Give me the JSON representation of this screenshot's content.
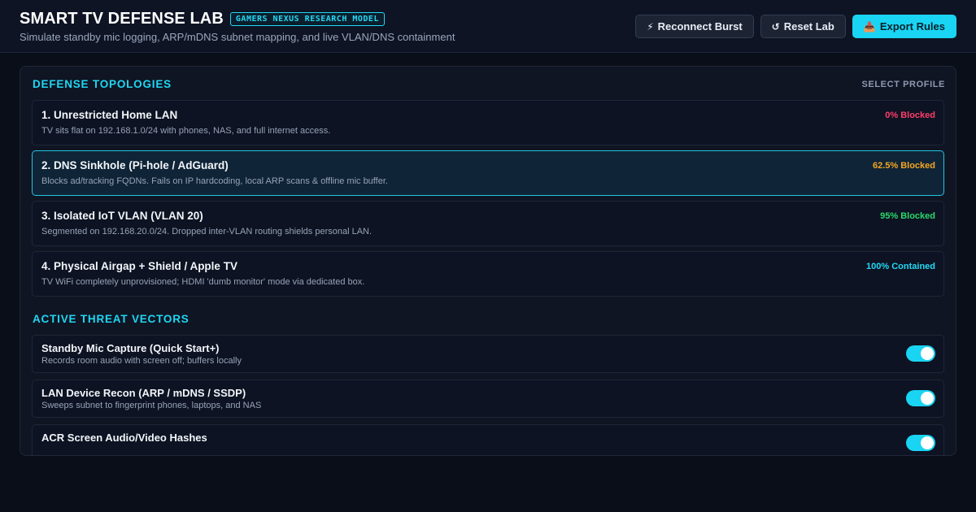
{
  "header": {
    "title": "SMART TV DEFENSE LAB",
    "badge": "GAMERS NEXUS RESEARCH MODEL",
    "subtitle": "Simulate standby mic logging, ARP/mDNS subnet mapping, and live VLAN/DNS containment"
  },
  "actions": {
    "reconnect": {
      "icon": "⚡",
      "icon_name": "lightning-icon",
      "label": "Reconnect Burst"
    },
    "reset": {
      "icon": "↺",
      "icon_name": "reset-icon",
      "label": "Reset Lab"
    },
    "export": {
      "icon": "📥",
      "icon_name": "download-icon",
      "label": "Export Rules"
    }
  },
  "topologies": {
    "title": "DEFENSE TOPOLOGIES",
    "hint": "SELECT PROFILE",
    "selected_index": 1,
    "items": [
      {
        "name": "1. Unrestricted Home LAN",
        "desc": "TV sits flat on 192.168.1.0/24 with phones, NAS, and full internet access.",
        "stat": "0% Blocked",
        "stat_color": "#ff3d6a"
      },
      {
        "name": "2. DNS Sinkhole (Pi-hole / AdGuard)",
        "desc": "Blocks ad/tracking FQDNs. Fails on IP hardcoding, local ARP scans & offline mic buffer.",
        "stat": "62.5% Blocked",
        "stat_color": "#f5a623"
      },
      {
        "name": "3. Isolated IoT VLAN (VLAN 20)",
        "desc": "Segmented on 192.168.20.0/24. Dropped inter-VLAN routing shields personal LAN.",
        "stat": "95% Blocked",
        "stat_color": "#2bd96b"
      },
      {
        "name": "4. Physical Airgap + Shield / Apple TV",
        "desc": "TV WiFi completely unprovisioned; HDMI 'dumb monitor' mode via dedicated box.",
        "stat": "100% Contained",
        "stat_color": "#22d8f5"
      }
    ]
  },
  "threats": {
    "title": "ACTIVE THREAT VECTORS",
    "accent": "#1ad4f3",
    "items": [
      {
        "name": "Standby Mic Capture (Quick Start+)",
        "desc": "Records room audio with screen off; buffers locally",
        "enabled": true
      },
      {
        "name": "LAN Device Recon (ARP / mDNS / SSDP)",
        "desc": "Sweeps subnet to fingerprint phones, laptops, and NAS",
        "enabled": true
      },
      {
        "name": "ACR Screen Audio/Video Hashes",
        "desc": "",
        "enabled": true
      }
    ]
  }
}
